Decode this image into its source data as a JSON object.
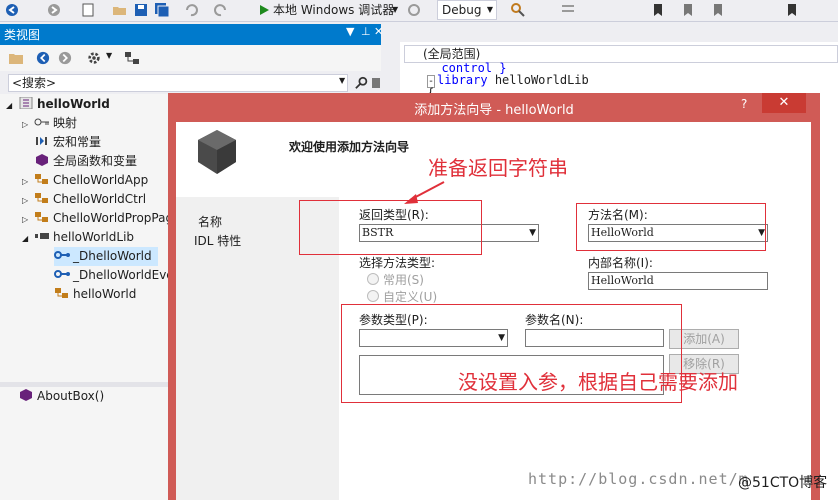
{
  "toolbar": {
    "run_label": "本地 Windows 调试器",
    "config_value": "Debug"
  },
  "class_view": {
    "title": "类视图",
    "search_placeholder": "<搜索>",
    "tree": [
      {
        "label": "helloWorld",
        "icon": "project-icon"
      },
      {
        "label": "映射",
        "icon": "map-icon"
      },
      {
        "label": "宏和常量",
        "icon": "macro-icon"
      },
      {
        "label": "全局函数和变量",
        "icon": "globals-icon"
      },
      {
        "label": "ChelloWorldApp",
        "icon": "class-icon"
      },
      {
        "label": "ChelloWorldCtrl",
        "icon": "class-icon"
      },
      {
        "label": "ChelloWorldPropPag",
        "icon": "class-icon"
      },
      {
        "label": "helloWorldLib",
        "icon": "library-icon"
      },
      {
        "label": "_DhelloWorld",
        "icon": "interface-icon"
      },
      {
        "label": "_DhelloWorldEve",
        "icon": "interface-icon"
      },
      {
        "label": "helloWorld",
        "icon": "class-icon"
      }
    ],
    "members": [
      {
        "label": "AboutBox()",
        "icon": "method-icon"
      }
    ]
  },
  "editor": {
    "scope": "(全局范围)",
    "lines": [
      {
        "text": "  control }",
        "kw": ""
      },
      {
        "text": "library helloWorldLib",
        "kw": "library"
      },
      {
        "text": "{",
        "kw": ""
      }
    ]
  },
  "dialog": {
    "title": "添加方法向导 - helloWorld",
    "help": "?",
    "close": "✕",
    "welcome": "欢迎使用添加方法向导",
    "nav": [
      "名称",
      "IDL 特性"
    ],
    "return_type_label": "返回类型(R):",
    "return_type_value": "BSTR",
    "method_name_label": "方法名(M):",
    "method_name_value": "HelloWorld",
    "select_method_type_label": "选择方法类型:",
    "radio_common": "常用(S)",
    "radio_custom": "自定义(U)",
    "internal_name_label": "内部名称(I):",
    "internal_name_value": "HelloWorld",
    "param_type_label": "参数类型(P):",
    "param_name_label": "参数名(N):",
    "add_button": "添加(A)",
    "remove_button": "移除(R)"
  },
  "annotations": {
    "return_string": "准备返回字符串",
    "no_params": "没设置入参，根据自己需要添加"
  },
  "watermark": {
    "url": "http://blog.csdn.net/m",
    "site": "@51CTO博客"
  }
}
